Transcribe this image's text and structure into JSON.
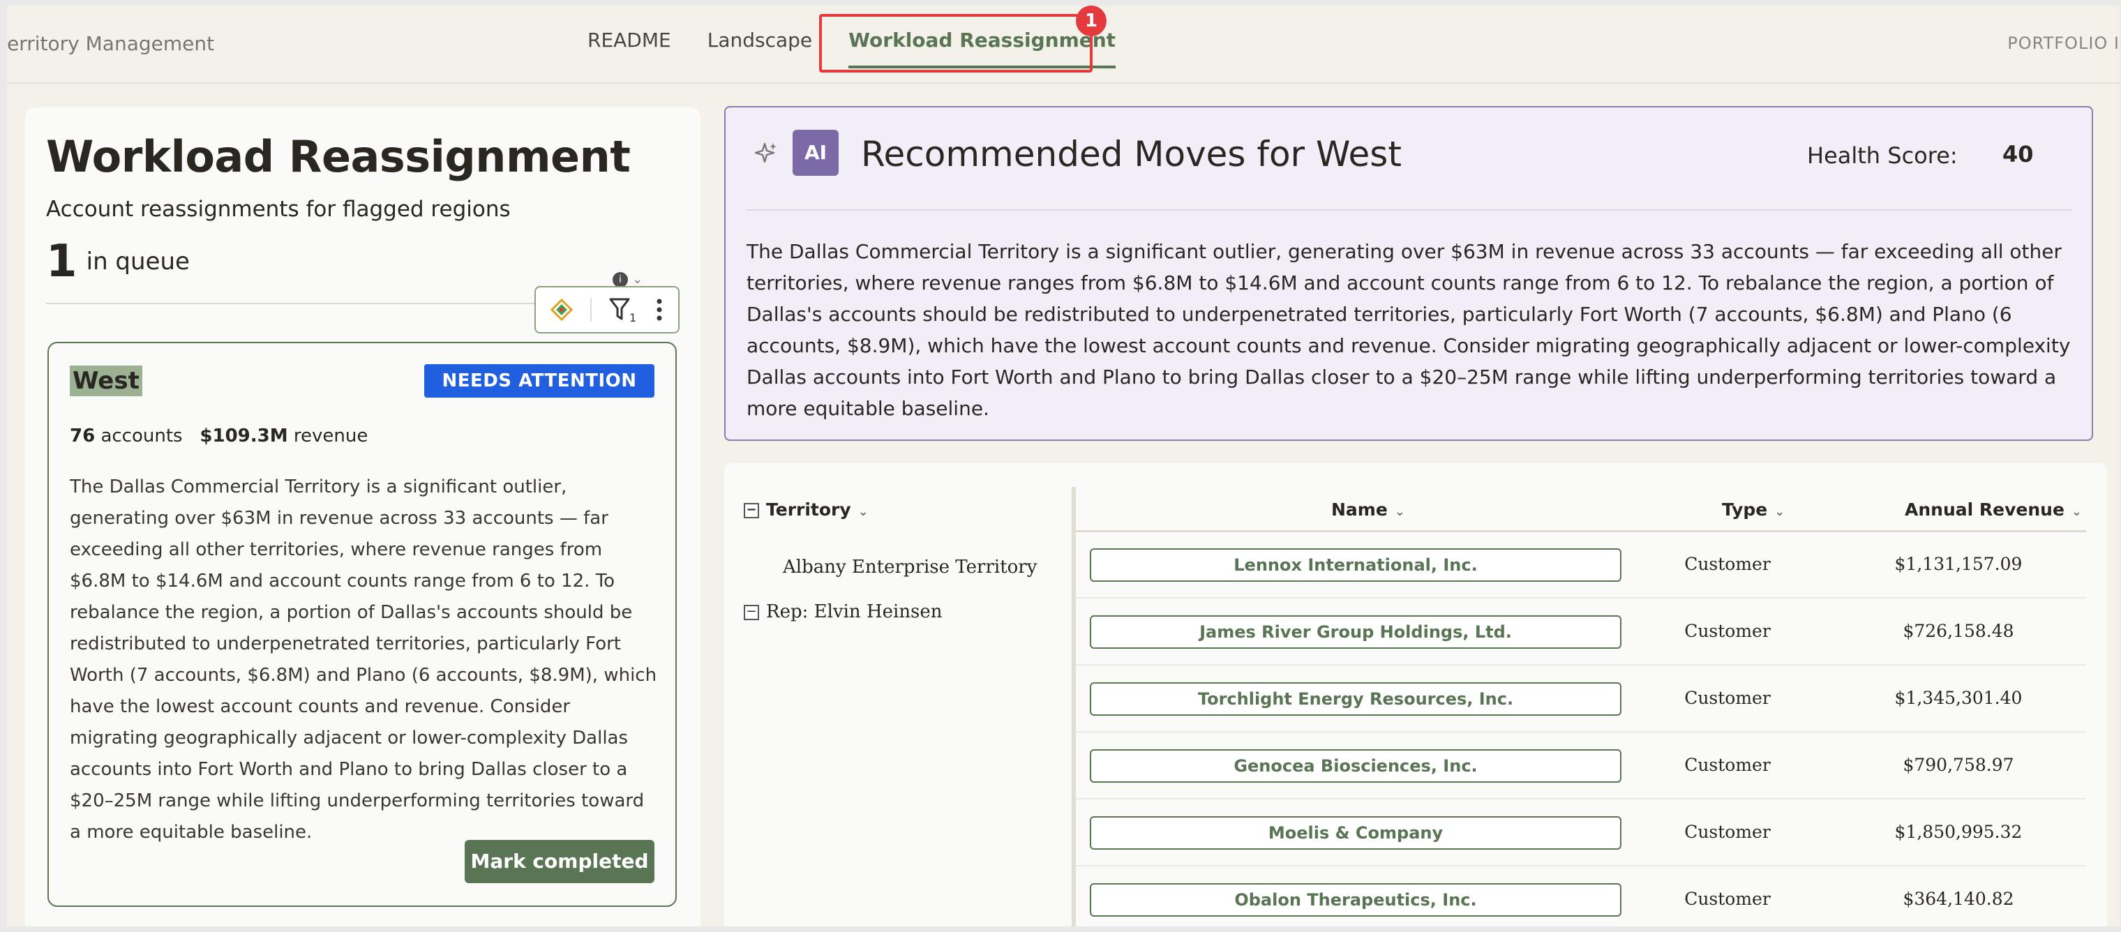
{
  "nav": {
    "brand": "erritory Management",
    "tabs": [
      {
        "label": "README"
      },
      {
        "label": "Landscape"
      },
      {
        "label": "Workload Reassignment",
        "active": true
      }
    ],
    "tab_badge": "1",
    "right_label": "PORTFOLIO I"
  },
  "left": {
    "title": "Workload Reassignment",
    "subtitle": "Account reassignments for flagged regions",
    "queue_count": "1",
    "queue_label": "in queue",
    "toolbar_filter_count": "1",
    "card": {
      "region": "West",
      "status": "NEEDS ATTENTION",
      "accounts_value": "76",
      "accounts_label": "accounts",
      "revenue_value": "$109.3M",
      "revenue_label": "revenue",
      "body": "The Dallas Commercial Territory is a significant outlier, generating over $63M in revenue across 33 accounts — far exceeding all other territories, where revenue ranges from $6.8M to $14.6M and account counts range from 6 to 12. To rebalance the region, a portion of Dallas's accounts should be redistributed to underpenetrated territories, particularly Fort Worth (7 accounts, $6.8M) and Plano (6 accounts, $8.9M), which have the lowest account counts and revenue. Consider migrating geographically adjacent or lower-complexity Dallas accounts into Fort Worth and Plano to bring Dallas closer to a $20–25M range while lifting underperforming territories toward a more equitable baseline.",
      "action_label": "Mark completed"
    }
  },
  "ai": {
    "badge": "AI",
    "title": "Recommended Moves for West",
    "health_label": "Health Score:",
    "health_value": "40",
    "body": "The Dallas Commercial Territory is a significant outlier, generating over $63M in revenue across 33 accounts — far exceeding all other territories, where revenue ranges from $6.8M to $14.6M and account counts range from 6 to 12. To rebalance the region, a portion of Dallas's accounts should be redistributed to underpenetrated territories, particularly Fort Worth (7 accounts, $6.8M) and Plano (6 accounts, $8.9M), which have the lowest account counts and revenue. Consider migrating geographically adjacent or lower-complexity Dallas accounts into Fort Worth and Plano to bring Dallas closer to a $20–25M range while lifting underperforming territories toward a more equitable baseline."
  },
  "table": {
    "headers": {
      "territory": "Territory",
      "name": "Name",
      "type": "Type",
      "revenue": "Annual Revenue"
    },
    "tree": {
      "territory": "Albany Enterprise Territory",
      "rep": "Rep: Elvin Heinsen"
    },
    "rows": [
      {
        "name": "Lennox International, Inc.",
        "type": "Customer",
        "revenue": "$1,131,157.09"
      },
      {
        "name": "James River Group Holdings, Ltd.",
        "type": "Customer",
        "revenue": "$726,158.48"
      },
      {
        "name": "Torchlight Energy Resources, Inc.",
        "type": "Customer",
        "revenue": "$1,345,301.40"
      },
      {
        "name": "Genocea Biosciences, Inc.",
        "type": "Customer",
        "revenue": "$790,758.97"
      },
      {
        "name": "Moelis & Company",
        "type": "Customer",
        "revenue": "$1,850,995.32"
      },
      {
        "name": "Obalon Therapeutics, Inc.",
        "type": "Customer",
        "revenue": "$364,140.82"
      }
    ]
  },
  "colors": {
    "accent": "#5a7553",
    "attention": "#1f5fe0",
    "ai_panel_bg": "#f2eef8",
    "ai_badge": "#7b6aa6",
    "highlight": "#e4393d"
  },
  "icons": [
    "sparkle-icon",
    "ai-badge",
    "gem-icon",
    "filter-icon",
    "more-vertical-icon",
    "chevron-down-icon",
    "collapse-icon"
  ]
}
